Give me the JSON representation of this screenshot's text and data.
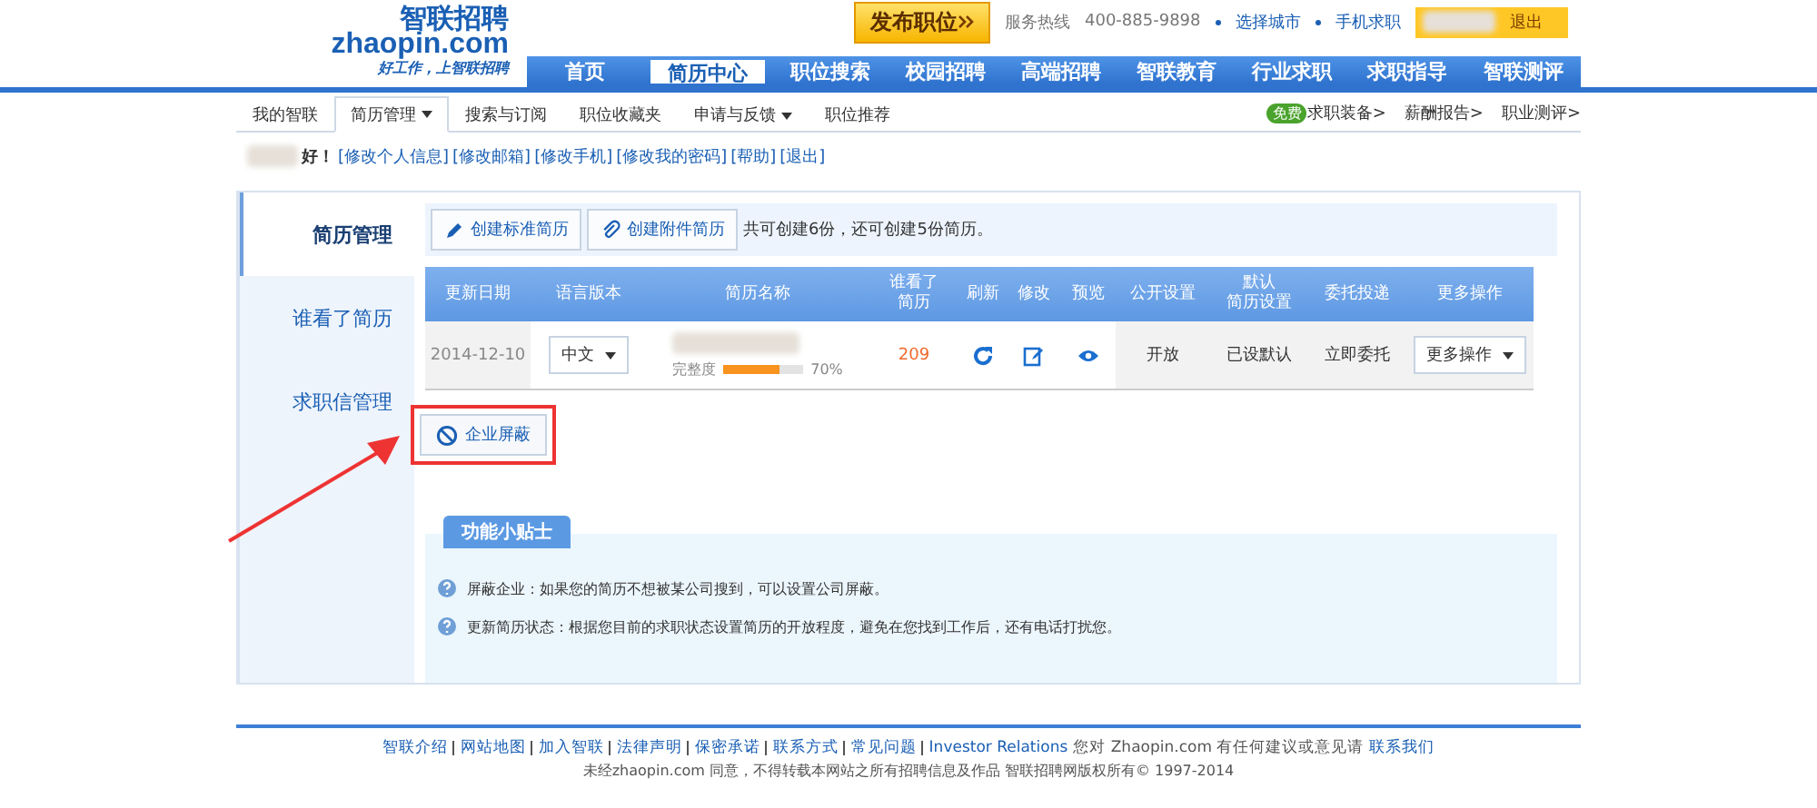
{
  "header": {
    "logo_name": "智联招聘",
    "logo_domain": "zhaopin.com",
    "slogan": "好工作，上智联招聘",
    "publish_button": "发布职位",
    "hotline_label": "服务热线",
    "hotline": "400-885-9898",
    "links": [
      "选择城市",
      "手机求职"
    ],
    "logout": "退出"
  },
  "nav_tabs": [
    {
      "label": "首页",
      "selected": false
    },
    {
      "label": "简历中心",
      "selected": true
    },
    {
      "label": "职位搜索",
      "selected": false
    },
    {
      "label": "校园招聘",
      "selected": false
    },
    {
      "label": "高端招聘",
      "selected": false
    },
    {
      "label": "智联教育",
      "selected": false
    },
    {
      "label": "行业求职",
      "selected": false
    },
    {
      "label": "求职指导",
      "selected": false
    },
    {
      "label": "智联测评",
      "selected": false
    }
  ],
  "subnav": {
    "items": [
      {
        "label": "我的智联",
        "selected": false,
        "dropdown": false
      },
      {
        "label": "简历管理",
        "selected": true,
        "dropdown": true
      },
      {
        "label": "搜索与订阅",
        "selected": false,
        "dropdown": false
      },
      {
        "label": "职位收藏夹",
        "selected": false,
        "dropdown": false
      },
      {
        "label": "申请与反馈",
        "selected": false,
        "dropdown": true
      },
      {
        "label": "职位推荐",
        "selected": false,
        "dropdown": false
      }
    ],
    "right_links": [
      {
        "label": "求职装备>",
        "badge": "免费"
      },
      {
        "label": "薪酬报告>"
      },
      {
        "label": "职业测评>"
      }
    ]
  },
  "greeting": {
    "text": "好！",
    "links": [
      "[修改个人信息]",
      "[修改邮箱]",
      "[修改手机]",
      "[修改我的密码]",
      "[帮助]",
      "[退出]"
    ]
  },
  "sidebar": {
    "items": [
      {
        "label": "简历管理",
        "selected": true
      },
      {
        "label": "谁看了简历",
        "selected": false
      },
      {
        "label": "求职信管理",
        "selected": false
      }
    ]
  },
  "toolbar": {
    "buttons": [
      {
        "label": "创建标准简历",
        "kind": "pencil"
      },
      {
        "label": "创建附件简历",
        "kind": "clip"
      }
    ],
    "note": "共可创建6份，还可创建5份简历。"
  },
  "table": {
    "columns": [
      {
        "lines": [
          "更新日期"
        ]
      },
      {
        "lines": [
          "语言版本"
        ]
      },
      {
        "lines": [
          "简历名称"
        ]
      },
      {
        "lines": [
          "谁看了",
          "简历"
        ]
      },
      {
        "lines": [
          "刷新"
        ]
      },
      {
        "lines": [
          "修改"
        ]
      },
      {
        "lines": [
          "预览"
        ]
      },
      {
        "lines": [
          "公开设置"
        ]
      },
      {
        "lines": [
          "默认",
          "简历设置"
        ]
      },
      {
        "lines": [
          "委托投递"
        ]
      },
      {
        "lines": [
          "更多操作"
        ]
      }
    ],
    "rows": [
      {
        "date": "2014-12-10",
        "language": "中文",
        "completeness_label": "完整度",
        "level": 0.7,
        "percent": "70%",
        "views": "209",
        "public": "开放",
        "default": "已设默认",
        "delegate": "立即委托",
        "more": "更多操作"
      }
    ]
  },
  "block_button": "企业屏蔽",
  "tips": {
    "title": "功能小贴士",
    "items": [
      "屏蔽企业：如果您的简历不想被某公司搜到，可以设置公司屏蔽。",
      "更新简历状态：根据您目前的求职状态设置简历的开放程度，避免在您找到工作后，还有电话打扰您。"
    ]
  },
  "footer": {
    "links": [
      "智联介绍",
      "网站地图",
      "加入智联",
      "法律声明",
      "保密承诺",
      "联系方式",
      "常见问题",
      "Investor Relations"
    ],
    "contact_text": "您对 Zhaopin.com 有任何建议或意见请",
    "contact_link": "联系我们",
    "copyright": "未经zhaopin.com 同意，不得转载本网站之所有招聘信息及作品 智联招聘网版权所有© 1997-2014"
  }
}
